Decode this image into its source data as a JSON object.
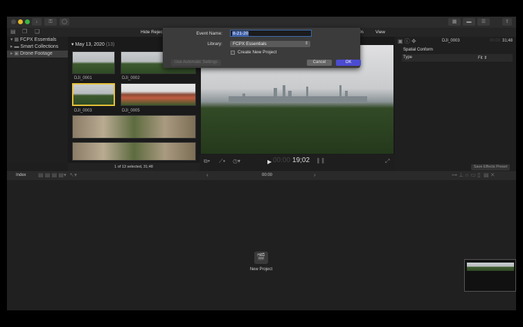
{
  "toolbar": {
    "hide_rejected": "Hide Rejected",
    "zoom_pct": "%",
    "view": "View"
  },
  "sidebar": {
    "library": "FCPX Essentials",
    "items": [
      {
        "label": "Smart Collections"
      },
      {
        "label": "Drone Footage"
      }
    ]
  },
  "browser": {
    "date": "May 13, 2020",
    "count": "(13)",
    "clips": [
      "DJI_0001",
      "DJI_0002",
      "DJI_0003",
      "DJI_0005"
    ],
    "status": "1 of 13 selected, 31;48"
  },
  "viewer": {
    "timecode_dim": "00:00",
    "timecode": "19;02"
  },
  "inspector": {
    "clip": "DJI_0003",
    "tc_dim": "00:00",
    "tc": "31;48",
    "section": "Spatial Conform",
    "type_label": "Type",
    "type_value": "Fit",
    "save_preset": "Save Effects Preset"
  },
  "timeline": {
    "index": "Index",
    "timecode": "00:00",
    "new_project": "New Project"
  },
  "dialog": {
    "event_name_label": "Event Name:",
    "event_name_value": "8-21-20",
    "library_label": "Library:",
    "library_value": "FCPX Essentials",
    "create_project": "Create New Project",
    "auto_settings": "Use Automatic Settings",
    "cancel": "Cancel",
    "ok": "OK"
  }
}
